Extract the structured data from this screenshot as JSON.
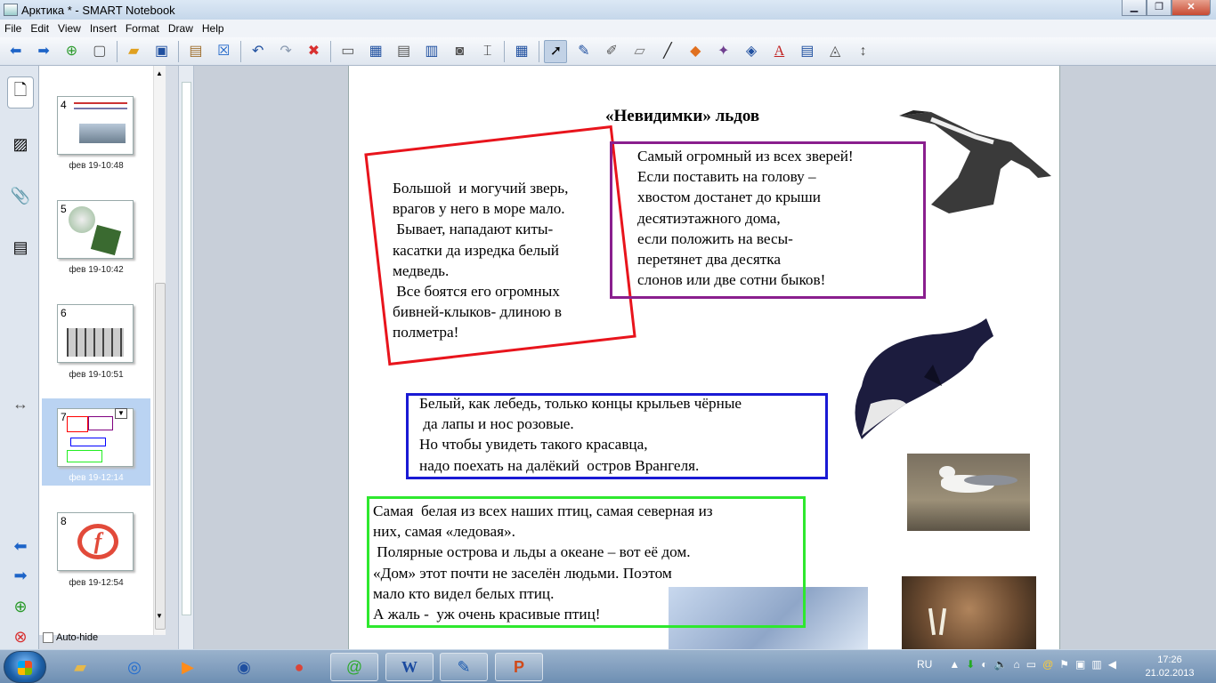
{
  "window": {
    "title": "Арктика * - SMART Notebook"
  },
  "menu": [
    "File",
    "Edit",
    "View",
    "Insert",
    "Format",
    "Draw",
    "Help"
  ],
  "toolbar_icons": [
    "back-icon",
    "forward-icon",
    "add-page-icon",
    "delete-page-icon",
    "open-icon",
    "save-icon",
    "paste-icon",
    "delete-icon",
    "undo-icon",
    "redo-icon",
    "cancel-icon",
    "screen-shade-icon",
    "full-screen-icon",
    "dual-page-icon",
    "show-hide-icon",
    "capture-icon",
    "document-camera-icon",
    "table-icon",
    "select-icon",
    "pen-icon",
    "creative-pen-icon",
    "eraser-icon",
    "line-icon",
    "shapes-icon",
    "magic-pen-icon",
    "fill-icon",
    "text-icon",
    "properties-icon",
    "measure-icon",
    "move-toolbar-icon"
  ],
  "pages": [
    {
      "num": "4",
      "time": "фев 19-10:48"
    },
    {
      "num": "5",
      "time": "фев 19-10:42"
    },
    {
      "num": "6",
      "time": "фев 19-10:51"
    },
    {
      "num": "7",
      "time": "фев 19-12:14",
      "selected": true
    },
    {
      "num": "8",
      "time": "фев 19-12:54"
    }
  ],
  "autohide_label": "Auto-hide",
  "slide": {
    "heading": "«Невидимки» льдов",
    "red_text": "Большой  и могучий зверь,\nврагов у него в море мало.\n Бывает, нападают киты-\nкасатки да изредка белый\nмедведь.\n Все боятся его огромных\nбивней-клыков- длиною в\nполметра!",
    "purple_text": "Самый огромный из всех зверей!\nЕсли поставить на голову –\nхвостом достанет до крыши\nдесятиэтажного дома,\nесли положить на весы-\nперетянет два десятка\nслонов или две сотни быков!",
    "blue_text": "Белый, как лебедь, только концы крыльев чёрные\n да лапы и нос розовые.\nНо чтобы увидеть такого красавца,\nнадо поехать на далёкий  остров Врангеля.",
    "green_text": "Самая  белая из всех наших птиц, самая северная из\nних, самая «ледовая».\n Полярные острова и льды а океане – вот её дом.\n«Дом» этот почти не заселён людьми. Поэтом\nмало кто видел белых птиц.\nА жаль -  уж очень красивые птиц!",
    "colors": {
      "red": "#e8141c",
      "purple": "#8a1f8e",
      "blue": "#1a1ad4",
      "green": "#2ee82e"
    }
  },
  "taskbar": {
    "apps": [
      "explorer-icon",
      "internet-icon",
      "media-player-icon",
      "network-icon",
      "chrome-icon",
      "agent-icon",
      "word-icon",
      "notebook-icon",
      "powerpoint-icon"
    ],
    "lang": "RU",
    "time": "17:26",
    "date": "21.02.2013"
  }
}
